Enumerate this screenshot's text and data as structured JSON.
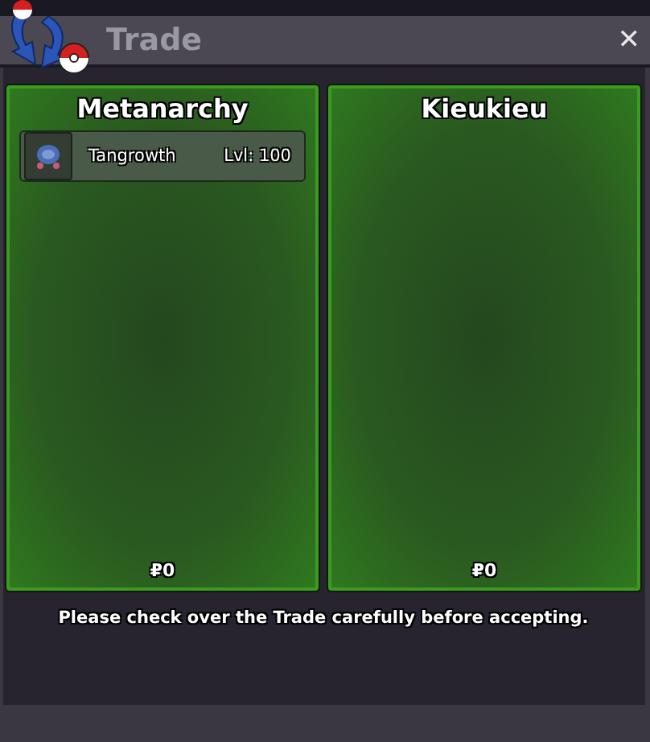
{
  "window": {
    "title": "Trade",
    "close": "✕"
  },
  "panels": [
    {
      "player": "Metanarchy",
      "offers": [
        {
          "name": "Tangrowth",
          "level": "Lvl: 100"
        }
      ],
      "money": "₽0"
    },
    {
      "player": "Kieukieu",
      "money": "₽0"
    }
  ],
  "message": "Please check over the Trade carefully before accepting."
}
